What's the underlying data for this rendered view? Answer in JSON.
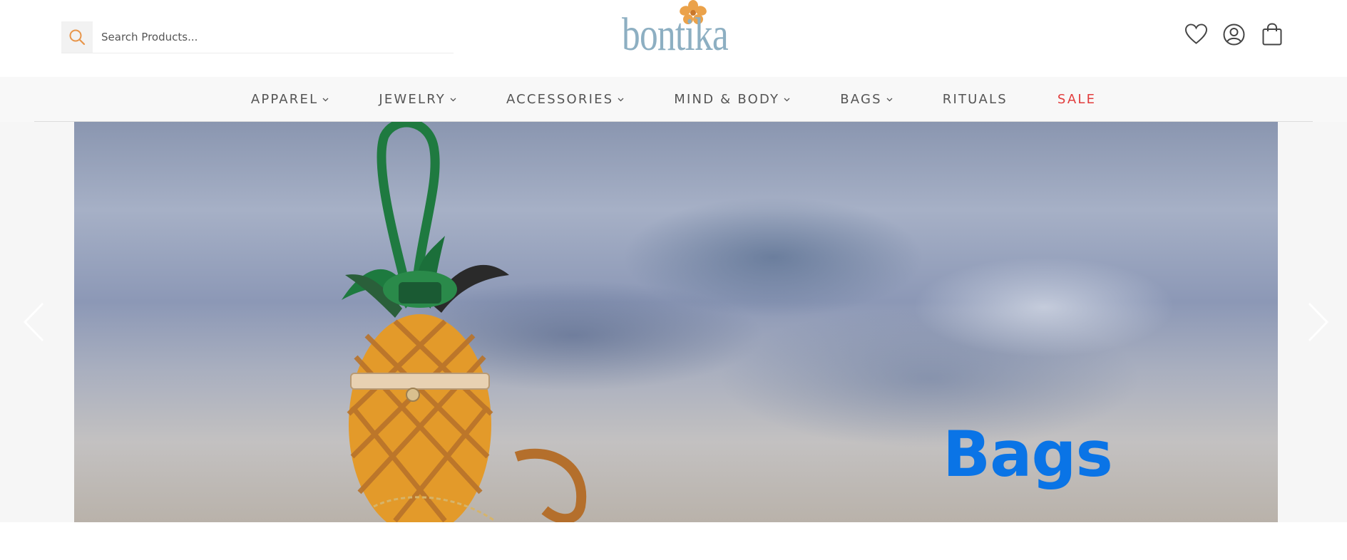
{
  "search": {
    "placeholder": "Search Products..."
  },
  "logo": {
    "text": "bontika"
  },
  "nav": {
    "items": [
      {
        "label": "APPAREL",
        "dropdown": true
      },
      {
        "label": "JEWELRY",
        "dropdown": true
      },
      {
        "label": "ACCESSORIES",
        "dropdown": true
      },
      {
        "label": "MIND & BODY",
        "dropdown": true
      },
      {
        "label": "BAGS",
        "dropdown": true
      },
      {
        "label": "RITUALS",
        "dropdown": false
      },
      {
        "label": "SALE",
        "dropdown": false
      }
    ]
  },
  "hero": {
    "title": "Bags"
  },
  "icons": {
    "search": "search-icon",
    "wishlist": "heart-icon",
    "account": "user-icon",
    "cart": "shopping-bag-icon",
    "prev": "chevron-left-icon",
    "next": "chevron-right-icon"
  },
  "colors": {
    "search_icon": "#e8954a",
    "logo_text": "#8dafc2",
    "logo_flower": "#eba24a",
    "nav_text": "#555555",
    "sale": "#e23d3d",
    "hero_title": "#0a74e6",
    "pineapple": "#e39a2a",
    "leaves": "#1d7a3f"
  }
}
